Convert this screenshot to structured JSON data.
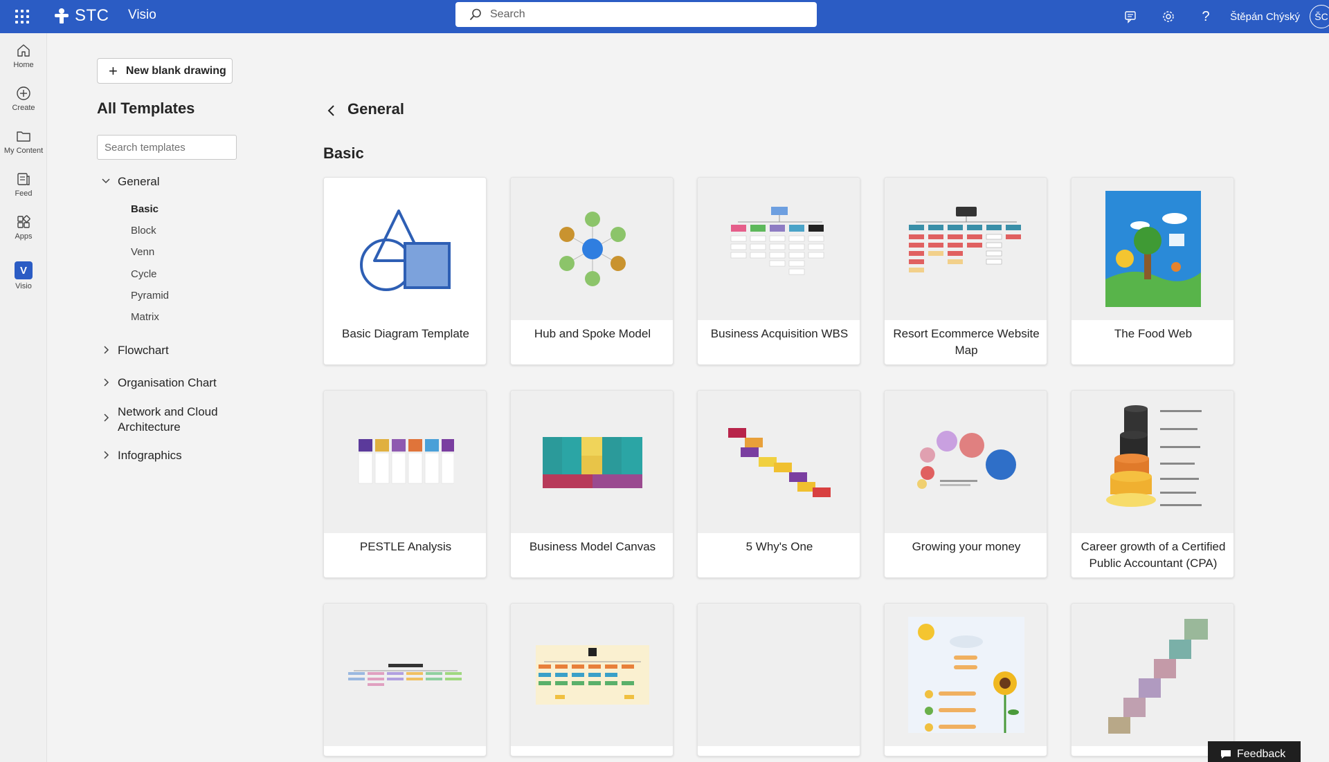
{
  "topbar": {
    "org_name": "STC",
    "app_name": "Visio",
    "search_placeholder": "Search",
    "user_name": "Štěpán Chýský",
    "user_initials": "ŠC",
    "bg_color": "#2b5cc4"
  },
  "rail": {
    "items": [
      {
        "label": "Home",
        "icon": "home-icon"
      },
      {
        "label": "Create",
        "icon": "plus-circle-icon"
      },
      {
        "label": "My Content",
        "icon": "folder-icon"
      },
      {
        "label": "Feed",
        "icon": "feed-icon"
      },
      {
        "label": "Apps",
        "icon": "apps-icon"
      },
      {
        "label": "Visio",
        "icon": "visio-icon"
      }
    ]
  },
  "sidebar": {
    "new_button": "New blank drawing",
    "title": "All Templates",
    "search_placeholder": "Search templates",
    "categories": [
      {
        "label": "General",
        "expanded": true
      },
      {
        "label": "Flowchart"
      },
      {
        "label": "Organisation Chart"
      },
      {
        "label": "Network and Cloud Architecture"
      },
      {
        "label": "Infographics"
      }
    ],
    "general_items": [
      "Basic",
      "Block",
      "Venn",
      "Cycle",
      "Pyramid",
      "Matrix"
    ]
  },
  "main": {
    "title": "General",
    "section": "Basic",
    "templates": [
      {
        "title": "Basic Diagram Template"
      },
      {
        "title": "Hub and Spoke Model"
      },
      {
        "title": "Business Acquisition WBS"
      },
      {
        "title": "Resort Ecommerce Website Map"
      },
      {
        "title": "The Food Web"
      },
      {
        "title": "PESTLE Analysis"
      },
      {
        "title": "Business Model Canvas"
      },
      {
        "title": "5 Why's One"
      },
      {
        "title": "Growing your money"
      },
      {
        "title": "Career growth of a Certified Public Accountant (CPA)"
      }
    ]
  },
  "feedback_label": "Feedback"
}
